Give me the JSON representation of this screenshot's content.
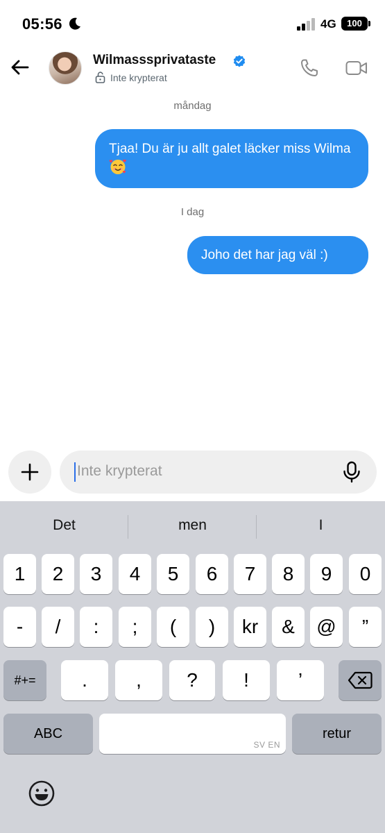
{
  "status_bar": {
    "time": "05:56",
    "network": "4G",
    "battery": "100",
    "icons": [
      "moon-icon",
      "signal-icon",
      "battery-icon"
    ]
  },
  "header": {
    "contact_name": "Wilmasssprivataste",
    "encryption_status": "Inte krypterat",
    "icons": [
      "back-arrow-icon",
      "verified-badge-icon",
      "lock-icon",
      "phone-icon",
      "video-camera-icon"
    ]
  },
  "conversation": {
    "day_1": "måndag",
    "message_1": "Tjaa! Du är ju allt galet läcker miss Wilma",
    "message_1_emoji": "smiling-face-with-hearts",
    "day_2": "I dag",
    "message_2": "Joho det har jag väl :)"
  },
  "composer": {
    "placeholder": "Inte krypterat",
    "icons": [
      "plus-icon",
      "microphone-icon"
    ]
  },
  "keyboard": {
    "suggestions": [
      "Det",
      "men",
      "I"
    ],
    "row1": [
      "1",
      "2",
      "3",
      "4",
      "5",
      "6",
      "7",
      "8",
      "9",
      "0"
    ],
    "row2": [
      "-",
      "/",
      ":",
      ";",
      "(",
      ")",
      "kr",
      "&",
      "@",
      "”"
    ],
    "row3_left": "#+=",
    "row3": [
      ".",
      ",",
      "?",
      "!",
      "’"
    ],
    "abc_label": "ABC",
    "return_label": "retur",
    "space_hint": "SV EN",
    "icons": [
      "backspace-icon",
      "emoji-icon"
    ]
  },
  "colors": {
    "bubble": "#2b8ff0",
    "verified": "#1f8cf0",
    "keyboard_bg": "#d1d3d9"
  }
}
